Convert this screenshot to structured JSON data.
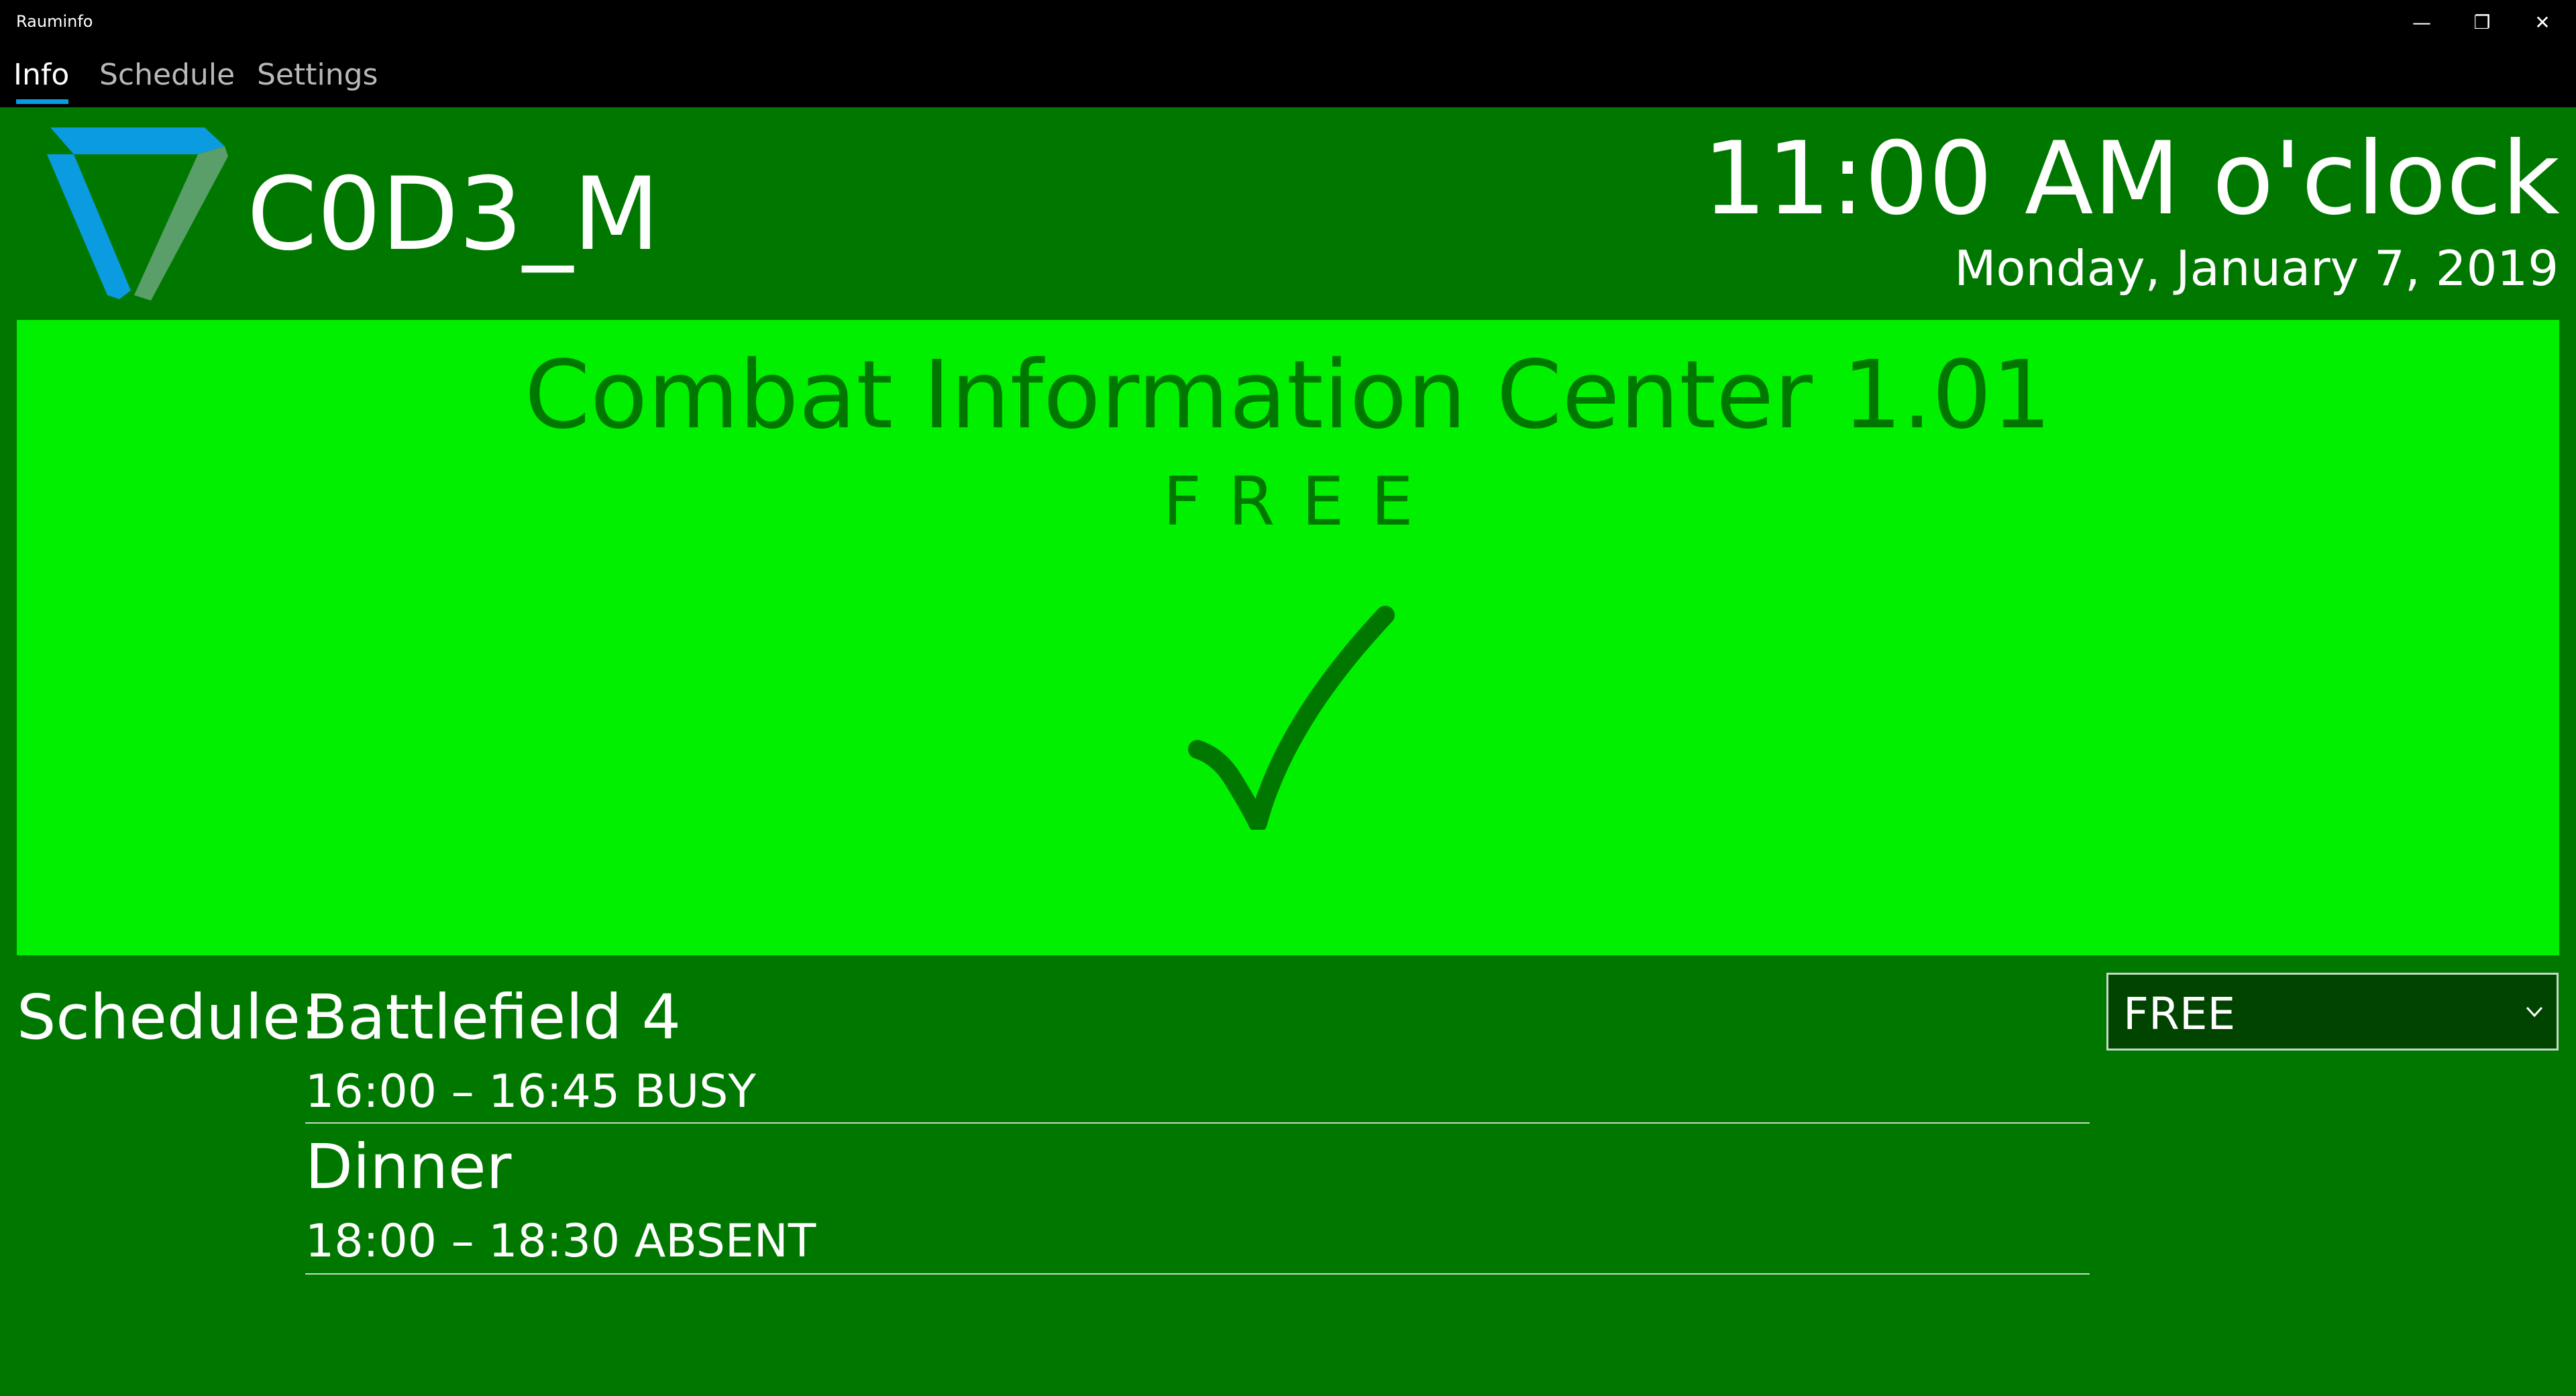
{
  "window": {
    "title": "Rauminfo",
    "minimize_glyph": "—",
    "maximize_glyph": "❐",
    "close_glyph": "✕"
  },
  "nav": {
    "tabs": [
      {
        "label": "Info",
        "active": true
      },
      {
        "label": "Schedule",
        "active": false
      },
      {
        "label": "Settings",
        "active": false
      }
    ]
  },
  "header": {
    "brand": "C0D3_M",
    "time": "11:00 AM o'clock",
    "date": "Monday, January 7, 2019"
  },
  "room": {
    "name": "Combat Information Center  1.01",
    "status": "FREE",
    "status_icon": "checkmark-icon"
  },
  "schedule": {
    "label": "Schedule:",
    "events": [
      {
        "title": "Battlefield 4",
        "time": "16:00 – 16:45",
        "status": "BUSY",
        "time_line": "16:00 – 16:45  BUSY"
      },
      {
        "title": "Dinner",
        "time": "18:00 – 18:30",
        "status": "ABSENT",
        "time_line": "18:00 – 18:30  ABSENT"
      }
    ]
  },
  "status_select": {
    "value": "FREE"
  },
  "colors": {
    "background": "#007800",
    "panel_free": "#00f000",
    "accent": "#0a9be0",
    "titlebar": "#000000"
  }
}
